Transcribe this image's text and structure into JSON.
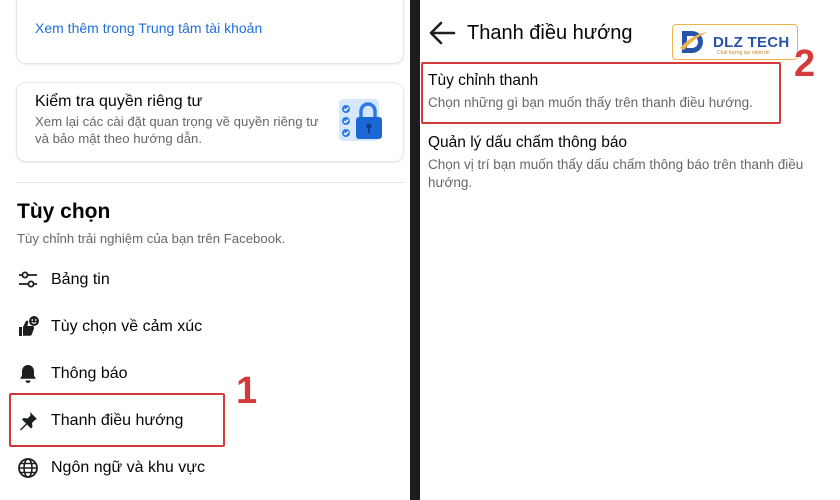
{
  "left": {
    "account_center_link": "Xem thêm trong Trung tâm tài khoản",
    "privacy_card": {
      "title": "Kiểm tra quyền riêng tư",
      "description": "Xem lại các cài đặt quan trọng về quyền riêng tư và bảo mật theo hướng dẫn."
    },
    "section": {
      "title": "Tùy chọn",
      "subtitle": "Tùy chỉnh trải nghiệm của bạn trên Facebook."
    },
    "menu": [
      {
        "label": "Bảng tin",
        "icon": "sliders-icon"
      },
      {
        "label": "Tùy chọn về cảm xúc",
        "icon": "reactions-icon"
      },
      {
        "label": "Thông báo",
        "icon": "bell-icon"
      },
      {
        "label": "Thanh điều hướng",
        "icon": "pin-icon"
      },
      {
        "label": "Ngôn ngữ và khu vực",
        "icon": "globe-icon"
      }
    ],
    "step_label": "1"
  },
  "right": {
    "header_title": "Thanh điều hướng",
    "logo_text": "DLZ TECH",
    "logo_tagline": "Chất lượng tạo niềm tin",
    "options": [
      {
        "title": "Tùy chỉnh thanh",
        "description": "Chọn những gì bạn muốn thấy trên thanh điều hướng."
      },
      {
        "title": "Quản lý dấu chấm thông báo",
        "description": "Chọn vị trí bạn muốn thấy dấu chấm thông báo trên thanh điều hướng."
      }
    ],
    "step_label": "2"
  },
  "colors": {
    "link": "#216fdb",
    "highlight": "#d43a3a",
    "secondary_text": "#65676b"
  }
}
